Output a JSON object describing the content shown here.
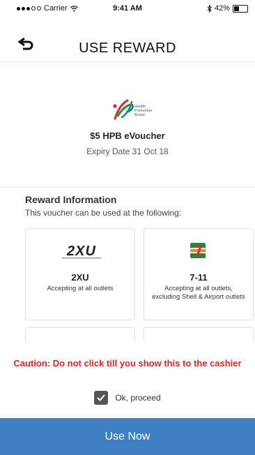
{
  "status_bar": {
    "carrier": "Carrier",
    "time": "9:41 AM",
    "battery_percent": "42%",
    "battery_level": 0.42
  },
  "header": {
    "title": "USE REWARD",
    "back_icon": "back-arrow-icon"
  },
  "voucher": {
    "logo_icon": "health-promotion-board-logo",
    "logo_text": [
      "Health",
      "Promotion",
      "Board"
    ],
    "title": "$5 HPB eVoucher",
    "expiry": "Expiry Date 31 Oct 18"
  },
  "reward_info": {
    "heading": "Reward Information",
    "subtitle": "This voucher can be used at the following:",
    "outlets": [
      {
        "logo": "2XU",
        "name": "2XU",
        "description": "Accepting at all outlets"
      },
      {
        "logo": "7-eleven-logo",
        "name": "7-11",
        "description": "Accepting at all outlets, excluding Shell & Airport outlets"
      }
    ]
  },
  "confirmation": {
    "caution": "Caution: Do not click till you show this to the cashier",
    "checkbox_checked": true,
    "checkbox_label": "Ok, proceed"
  },
  "action": {
    "button_label": "Use Now"
  },
  "colors": {
    "accent": "#3f80c4",
    "caution": "#e0262b"
  }
}
